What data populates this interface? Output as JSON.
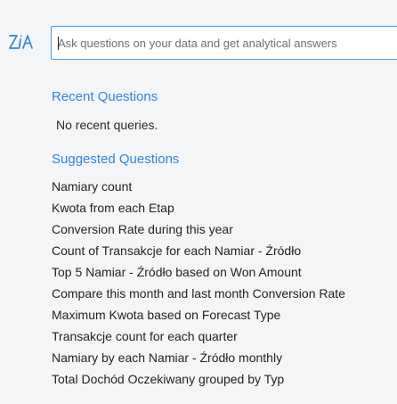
{
  "brand": {
    "logo_icon": "zia-logo-icon",
    "logo_color": "#2f86d6"
  },
  "search": {
    "placeholder": "Ask questions on your data and get analytical answers",
    "value": ""
  },
  "recent": {
    "title": "Recent Questions",
    "empty_message": "No recent queries."
  },
  "suggested": {
    "title": "Suggested Questions",
    "items": [
      "Namiary count",
      "Kwota from each Etap",
      "Conversion Rate during this year",
      "Count of Transakcje for each Namiar - Źródło",
      "Top 5 Namiar - Źródło based on Won Amount",
      "Compare this month and last month Conversion Rate",
      "Maximum Kwota based on Forecast Type",
      "Transakcje count for each quarter",
      "Namiary by each Namiar - Źródło monthly",
      "Total Dochód Oczekiwany grouped by Typ"
    ]
  },
  "colors": {
    "accent": "#2f86d6",
    "focus_border": "#4a9be0",
    "background": "#f4f5f7"
  }
}
